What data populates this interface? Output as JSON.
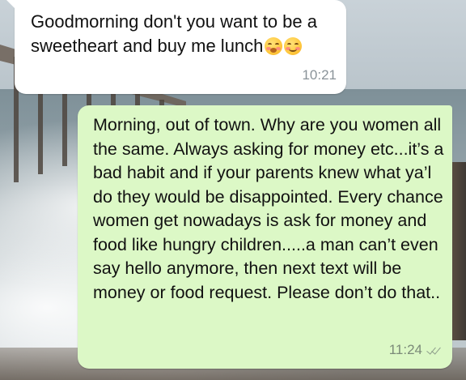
{
  "chat": {
    "incoming": {
      "text": "Goodmorning don't you want to be a sweetheart and buy me lunch",
      "emojis": [
        "blushing-smile-icon",
        "smiling-icon"
      ],
      "time": "10:21"
    },
    "outgoing": {
      "text": "Morning, out of town. Why are you women all the same. Always asking for money etc...it’s a bad habit and if your parents knew what ya’l do they would be disappointed. Every chance women get nowadays is ask for money and food like hungry children.....a man can’t even say hello anymore, then next text will be money or food request. Please don’t do that..",
      "time": "11:24",
      "status": "read-ticks-icon"
    }
  },
  "colors": {
    "incoming_bubble": "#ffffff",
    "outgoing_bubble": "#dcf8c6",
    "timestamp": "#8a9399"
  }
}
